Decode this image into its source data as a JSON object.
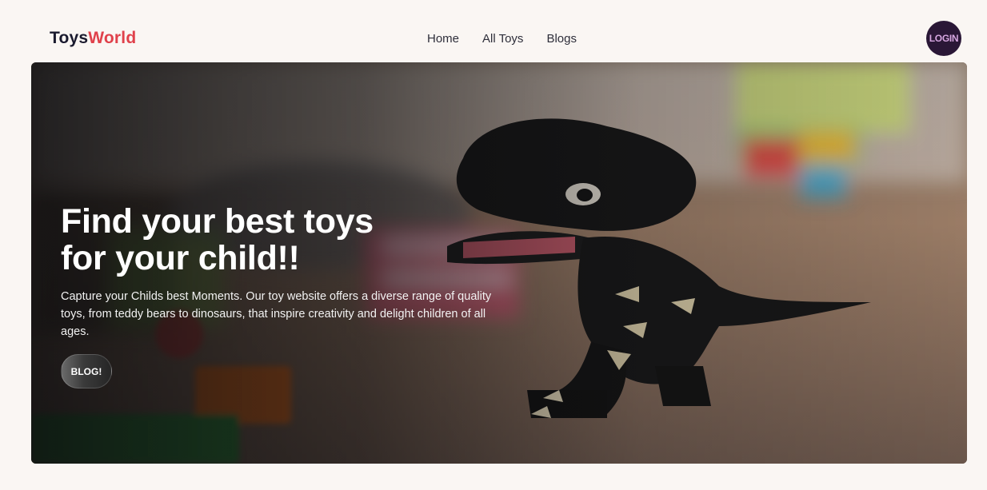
{
  "header": {
    "logo_part1": "Toys",
    "logo_part2": "World",
    "nav": [
      {
        "label": "Home"
      },
      {
        "label": "All Toys"
      },
      {
        "label": "Blogs"
      }
    ],
    "login_label": "LOGIN"
  },
  "hero": {
    "title_line1": "Find your best toys",
    "title_line2": "for your child!!",
    "description": "Capture your Childs best Moments. Our toy website offers a diverse range of quality toys, from teddy bears to dinosaurs, that inspire creativity and delight children of all ages.",
    "button_label": "BLOG!"
  },
  "colors": {
    "brand_dark": "#1a1a2e",
    "brand_accent": "#e0414b",
    "login_bg": "#2a1736",
    "page_bg": "#faf6f3"
  }
}
